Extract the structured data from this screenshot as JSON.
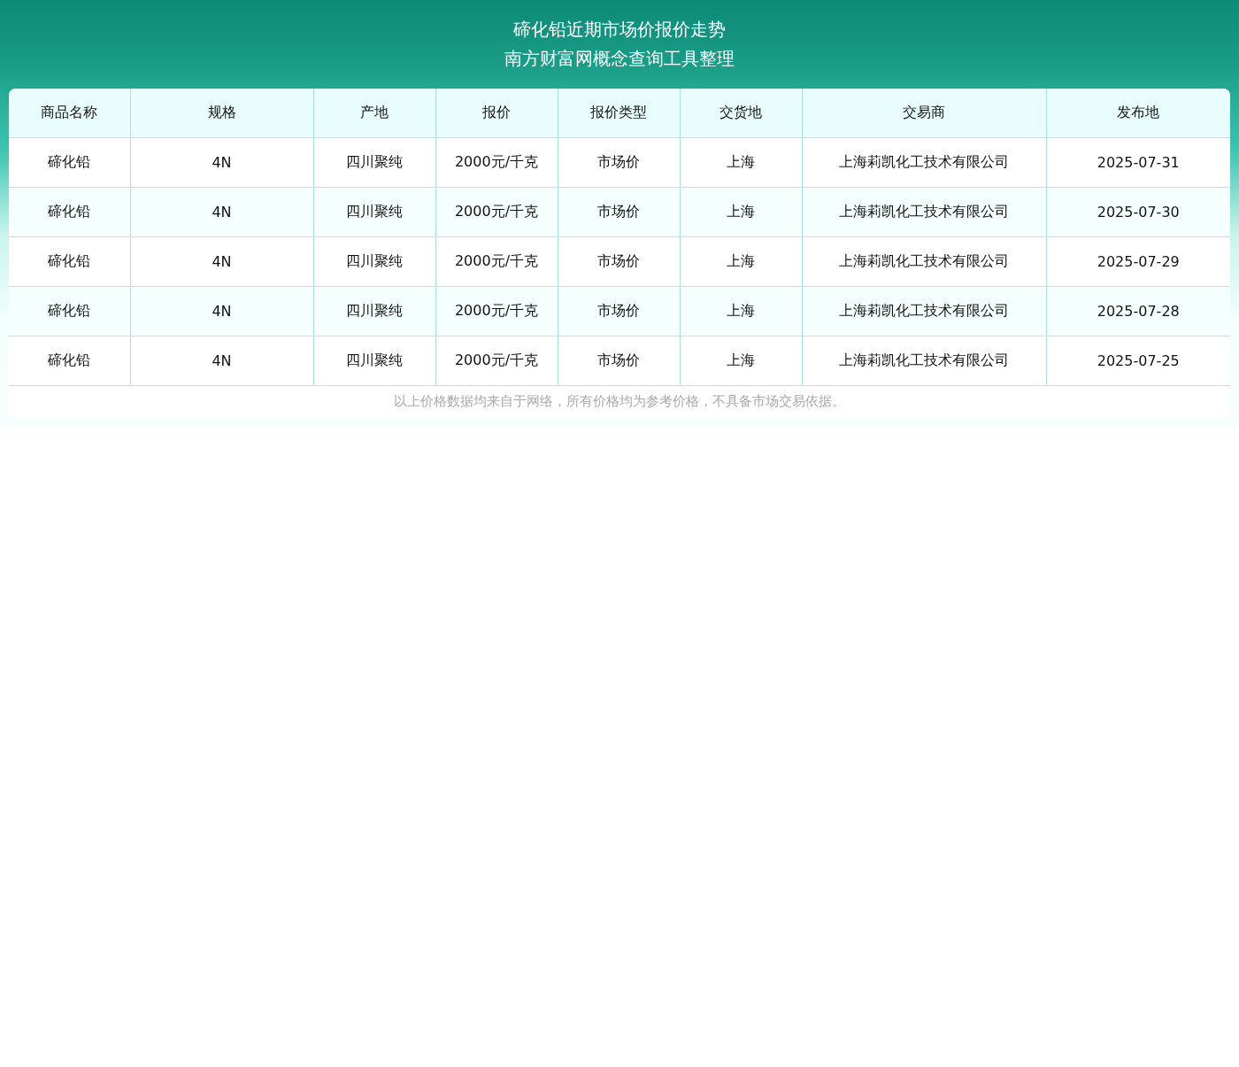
{
  "header": {
    "title": "碲化铅近期市场价报价走势",
    "subtitle": "南方财富网概念查询工具整理"
  },
  "table": {
    "columns": [
      "商品名称",
      "规格",
      "产地",
      "报价",
      "报价类型",
      "交货地",
      "交易商",
      "发布地"
    ],
    "rows": [
      [
        "碲化铅",
        "4N",
        "四川聚纯",
        "2000元/千克",
        "市场价",
        "上海",
        "上海莉凯化工技术有限公司",
        "2025-07-31"
      ],
      [
        "碲化铅",
        "4N",
        "四川聚纯",
        "2000元/千克",
        "市场价",
        "上海",
        "上海莉凯化工技术有限公司",
        "2025-07-30"
      ],
      [
        "碲化铅",
        "4N",
        "四川聚纯",
        "2000元/千克",
        "市场价",
        "上海",
        "上海莉凯化工技术有限公司",
        "2025-07-29"
      ],
      [
        "碲化铅",
        "4N",
        "四川聚纯",
        "2000元/千克",
        "市场价",
        "上海",
        "上海莉凯化工技术有限公司",
        "2025-07-28"
      ],
      [
        "碲化铅",
        "4N",
        "四川聚纯",
        "2000元/千克",
        "市场价",
        "上海",
        "上海莉凯化工技术有限公司",
        "2025-07-25"
      ]
    ]
  },
  "footnote": "以上价格数据均来自于网络，所有价格均为参考价格，不具备市场交易依据。"
}
